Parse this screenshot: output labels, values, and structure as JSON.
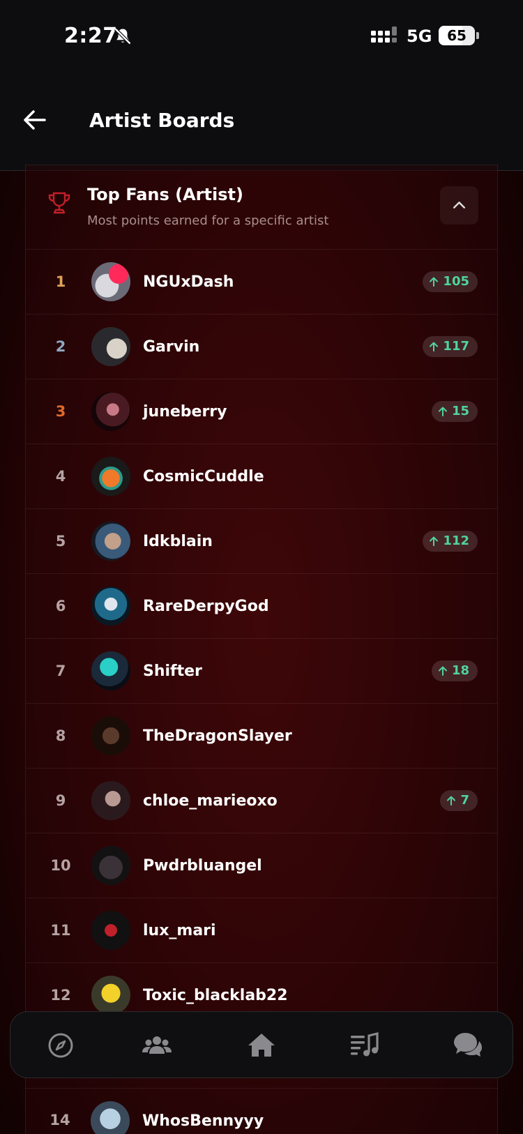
{
  "status_bar": {
    "time": "2:27",
    "network": "5G",
    "battery": "65",
    "battery_fraction": 0.65
  },
  "header": {
    "title": "Artist Boards"
  },
  "board": {
    "title": "Top Fans (Artist)",
    "subtitle": "Most points earned for a specific artist",
    "rows": [
      {
        "rank": "1",
        "username": "NGUxDash",
        "change": "105"
      },
      {
        "rank": "2",
        "username": "Garvin",
        "change": "117"
      },
      {
        "rank": "3",
        "username": "juneberry",
        "change": "15"
      },
      {
        "rank": "4",
        "username": "CosmicCuddle",
        "change": ""
      },
      {
        "rank": "5",
        "username": "Idkblain",
        "change": "112"
      },
      {
        "rank": "6",
        "username": "RareDerpyGod",
        "change": ""
      },
      {
        "rank": "7",
        "username": "Shifter",
        "change": "18"
      },
      {
        "rank": "8",
        "username": "TheDragonSlayer",
        "change": ""
      },
      {
        "rank": "9",
        "username": "chloe_marieoxo",
        "change": "7"
      },
      {
        "rank": "10",
        "username": "Pwdrbluangel",
        "change": ""
      },
      {
        "rank": "11",
        "username": "lux_mari",
        "change": ""
      },
      {
        "rank": "12",
        "username": "Toxic_blacklab22",
        "change": ""
      },
      {
        "rank": "14",
        "username": "WhosBennyyy",
        "change": ""
      }
    ]
  },
  "nav": {
    "items": [
      {
        "icon": "compass-icon"
      },
      {
        "icon": "people-icon"
      },
      {
        "icon": "home-icon"
      },
      {
        "icon": "playlist-icon"
      },
      {
        "icon": "chat-icon"
      }
    ]
  },
  "colors": {
    "accent_green": "#4fd49b",
    "gold": "#e1a15a",
    "silver": "#8fa8c4",
    "bronze": "#e06a2c",
    "trophy_red": "#c0202a"
  }
}
